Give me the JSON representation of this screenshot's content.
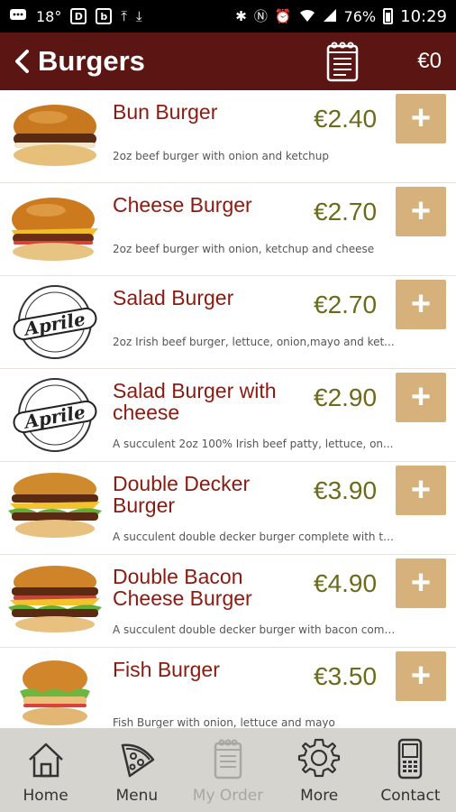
{
  "status_bar": {
    "temperature": "18°",
    "battery": "76%",
    "time": "10:29"
  },
  "header": {
    "title": "Burgers",
    "cart_total": "€0"
  },
  "items": [
    {
      "name": "Bun Burger",
      "price": "€2.40",
      "description": "2oz beef burger with onion and ketchup",
      "add_label": "+",
      "thumb": "burger"
    },
    {
      "name": "Cheese Burger",
      "price": "€2.70",
      "description": "2oz beef burger with onion, ketchup and cheese",
      "add_label": "+",
      "thumb": "burger"
    },
    {
      "name": "Salad Burger",
      "price": "€2.70",
      "description": "2oz Irish beef burger, lettuce, onion,mayo and ket...",
      "add_label": "+",
      "thumb": "logo"
    },
    {
      "name": "Salad Burger with cheese",
      "price": "€2.90",
      "description": "A succulent 2oz 100% Irish beef patty, lettuce, on...",
      "add_label": "+",
      "thumb": "logo"
    },
    {
      "name": "Double Decker Burger",
      "price": "€3.90",
      "description": "A succulent double decker burger complete with two...",
      "add_label": "+",
      "thumb": "burger"
    },
    {
      "name": "Double Bacon Cheese Burger",
      "price": "€4.90",
      "description": "A succulent double decker burger with bacon comple...",
      "add_label": "+",
      "thumb": "burger"
    },
    {
      "name": "Fish Burger",
      "price": "€3.50",
      "description": "Fish Burger with onion, lettuce and mayo",
      "add_label": "+",
      "thumb": "burger"
    }
  ],
  "logo_text": "Aprile",
  "bottom_nav": {
    "home": "Home",
    "menu": "Menu",
    "my_order": "My Order",
    "more": "More",
    "contact": "Contact"
  },
  "colors": {
    "appbar": "#5b1512",
    "item_name": "#8b1a11",
    "price": "#6c6a1c",
    "add_button": "#d7b17c",
    "bottom_nav": "#d6d4ce"
  }
}
